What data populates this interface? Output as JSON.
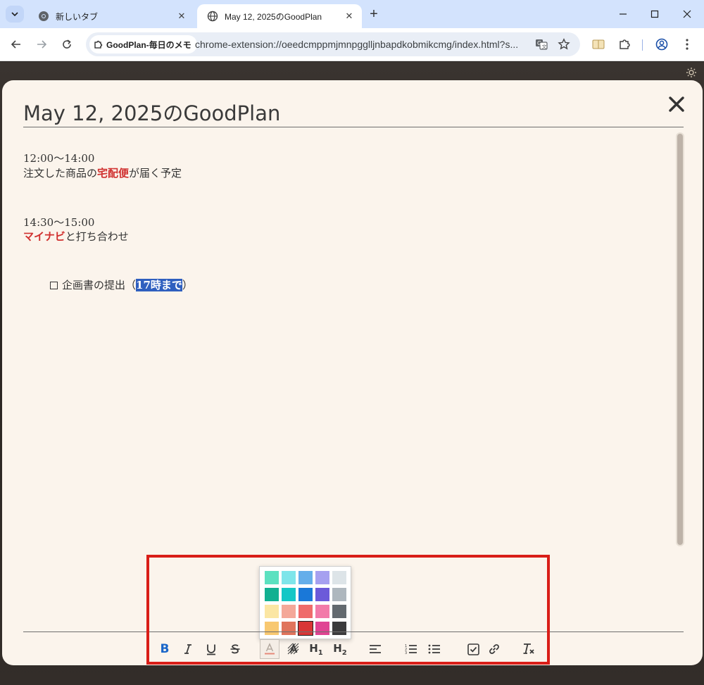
{
  "browser": {
    "tabs": [
      {
        "title": "新しいタブ",
        "active": false
      },
      {
        "title": "May 12, 2025のGoodPlan",
        "active": true
      }
    ],
    "chip_label": "GoodPlan-毎日のメモ",
    "url": "chrome-extension://oeedcmppmjmnpgglljnbapdkobmikcmg/index.html?s..."
  },
  "modal": {
    "title": "May 12, 2025のGoodPlan",
    "content": {
      "entry1": {
        "time": "12:00～14:00",
        "text_before": "注文した商品の",
        "highlight": "宅配便",
        "text_after": "が届く予定"
      },
      "entry2": {
        "time": "14:30～15:00",
        "highlight": "マイナビ",
        "text_after": "と打ち合わせ"
      },
      "todo": {
        "text_before": "企画書の提出（",
        "selected": "17時まで",
        "text_after": "）"
      }
    }
  },
  "color_picker": {
    "rows": [
      [
        "#5ce1c0",
        "#7ee5ea",
        "#65aeea",
        "#a6a0f0",
        "#dde4e8"
      ],
      [
        "#12b091",
        "#14c7c6",
        "#1a78d8",
        "#6c5ad9",
        "#aeb7be"
      ],
      [
        "#fbe6a3",
        "#f4a899",
        "#ef6b6b",
        "#f27aa9",
        "#636a70"
      ],
      [
        "#f8c870",
        "#e0745c",
        "#d93636",
        "#e04493",
        "#3b3b3d"
      ]
    ],
    "selected": "#d93636"
  },
  "colors": {
    "accent_red": "#d0302f",
    "selection_blue": "#2f5fbf",
    "bold_blue": "#1a66c9",
    "annotation_red": "#d91e18",
    "modal_bg": "#fbf4ec"
  }
}
